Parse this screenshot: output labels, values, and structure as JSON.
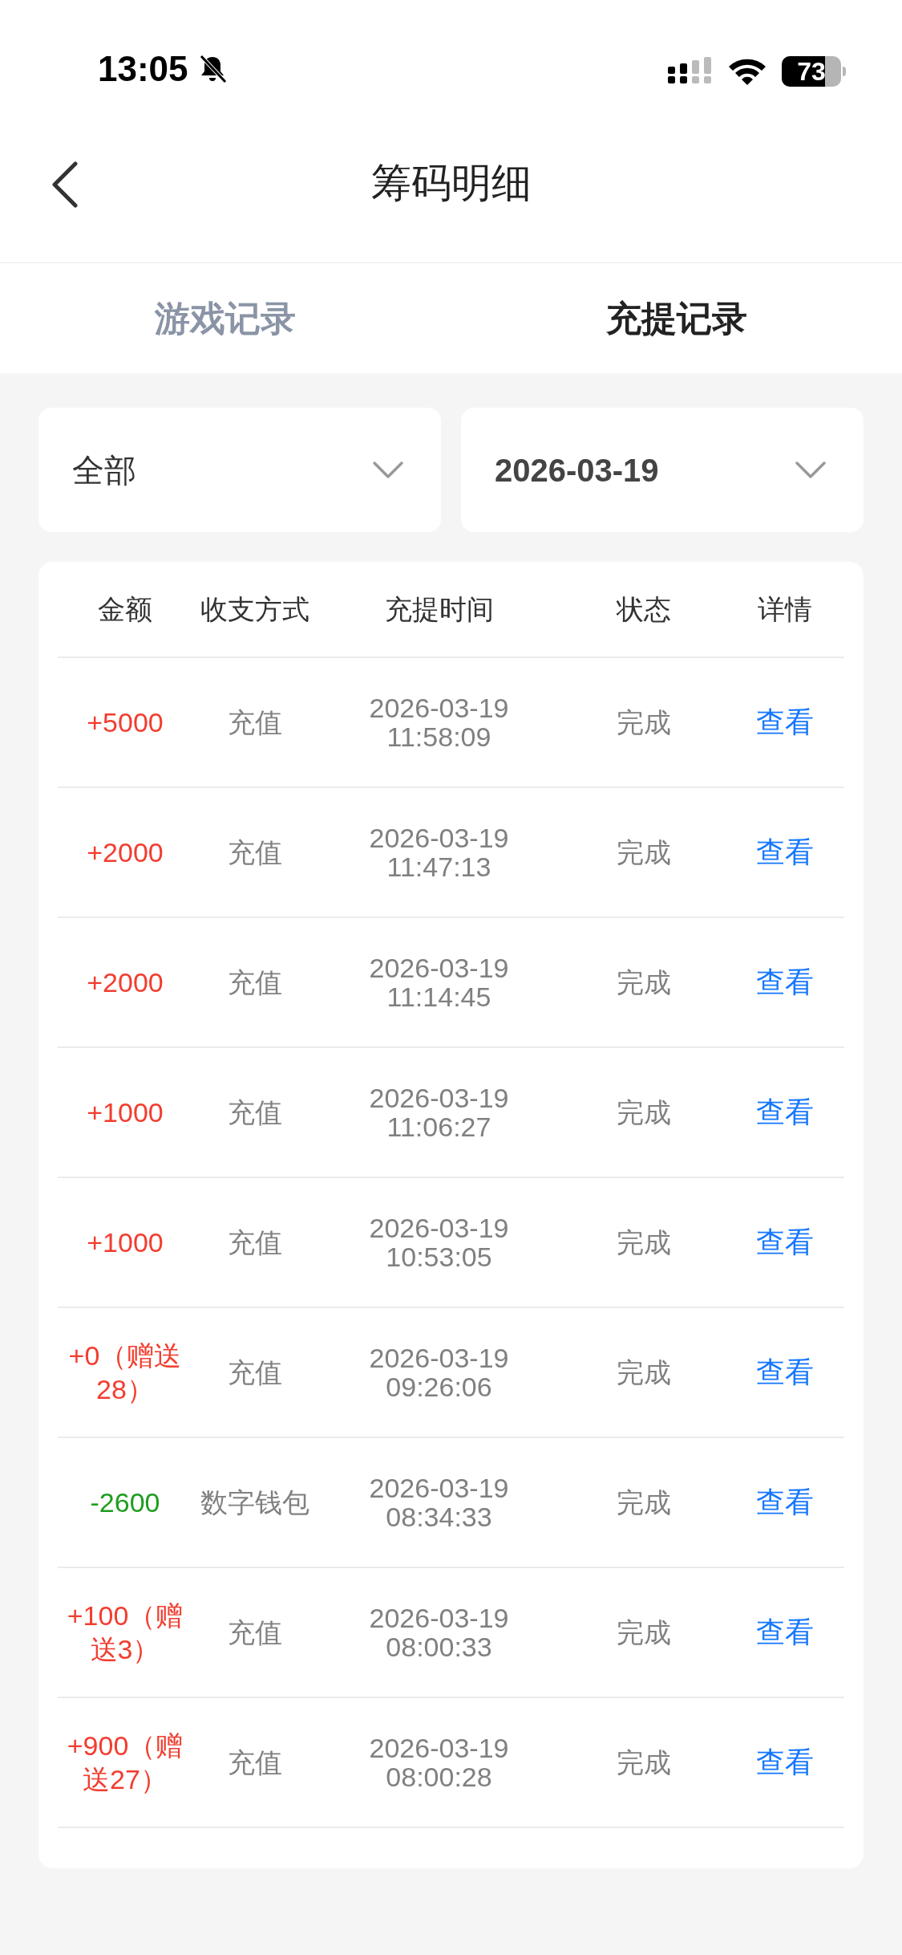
{
  "status_bar": {
    "time": "13:05",
    "battery": "73"
  },
  "header": {
    "title": "筹码明细"
  },
  "tabs": [
    {
      "label": "游戏记录",
      "selected": false
    },
    {
      "label": "充提记录",
      "selected": true
    }
  ],
  "filters": [
    {
      "value": "全部",
      "kind": "category"
    },
    {
      "value": "2026-03-19",
      "kind": "date"
    }
  ],
  "table": {
    "columns": [
      "金额",
      "收支方式",
      "充提时间",
      "状态",
      "详情"
    ],
    "rows": [
      {
        "amount": "+5000",
        "kind": "credit",
        "method": "充值",
        "time": "2026-03-19 11:58:09",
        "status": "完成",
        "action": "查看"
      },
      {
        "amount": "+2000",
        "kind": "credit",
        "method": "充值",
        "time": "2026-03-19 11:47:13",
        "status": "完成",
        "action": "查看"
      },
      {
        "amount": "+2000",
        "kind": "credit",
        "method": "充值",
        "time": "2026-03-19 11:14:45",
        "status": "完成",
        "action": "查看"
      },
      {
        "amount": "+1000",
        "kind": "credit",
        "method": "充值",
        "time": "2026-03-19 11:06:27",
        "status": "完成",
        "action": "查看"
      },
      {
        "amount": "+1000",
        "kind": "credit",
        "method": "充值",
        "time": "2026-03-19 10:53:05",
        "status": "完成",
        "action": "查看"
      },
      {
        "amount": "+0（赠送28）",
        "kind": "credit",
        "method": "充值",
        "time": "2026-03-19 09:26:06",
        "status": "完成",
        "action": "查看"
      },
      {
        "amount": "-2600",
        "kind": "debit",
        "method": "数字钱包",
        "time": "2026-03-19 08:34:33",
        "status": "完成",
        "action": "查看"
      },
      {
        "amount": "+100（赠送3）",
        "kind": "credit",
        "method": "充值",
        "time": "2026-03-19 08:00:33",
        "status": "完成",
        "action": "查看"
      },
      {
        "amount": "+900（赠送27）",
        "kind": "credit",
        "method": "充值",
        "time": "2026-03-19 08:00:28",
        "status": "完成",
        "action": "查看"
      }
    ]
  }
}
